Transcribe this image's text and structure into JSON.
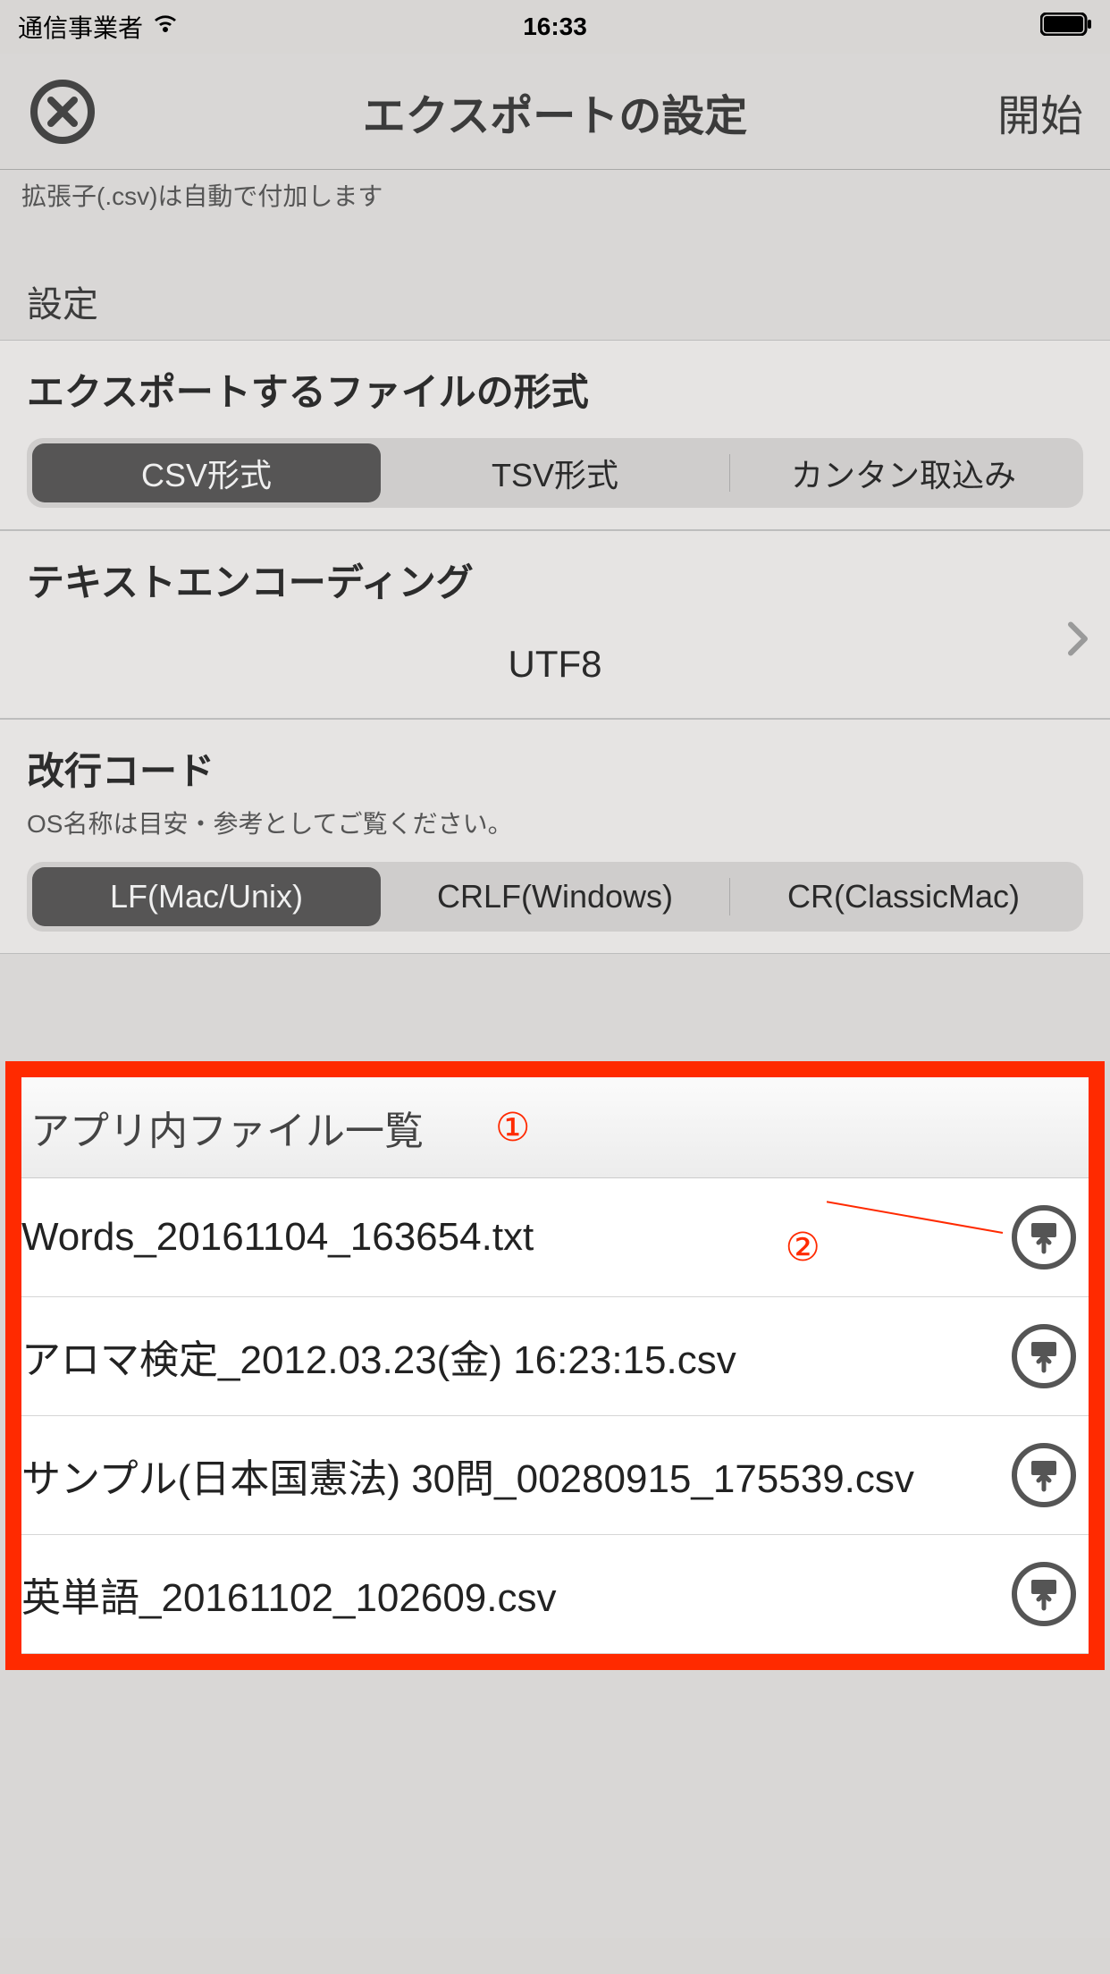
{
  "status": {
    "carrier": "通信事業者",
    "time": "16:33"
  },
  "nav": {
    "title": "エクスポートの設定",
    "start": "開始"
  },
  "hint": "拡張子(.csv)は自動で付加します",
  "sections": {
    "settings_header": "設定",
    "format": {
      "title": "エクスポートするファイルの形式",
      "options": [
        "CSV形式",
        "TSV形式",
        "カンタン取込み"
      ],
      "selected": 0
    },
    "encoding": {
      "title": "テキストエンコーディング",
      "value": "UTF8"
    },
    "newline": {
      "title": "改行コード",
      "sub": "OS名称は目安・参考としてご覧ください。",
      "options": [
        "LF(Mac/Unix)",
        "CRLF(Windows)",
        "CR(ClassicMac)"
      ],
      "selected": 0
    }
  },
  "files": {
    "header": "アプリ内ファイル一覧",
    "annotation1": "①",
    "annotation2": "②",
    "items": [
      "Words_20161104_163654.txt",
      "アロマ検定_2012.03.23(金) 16:23:15.csv",
      "サンプル(日本国憲法) 30問_00280915_175539.csv",
      "英単語_20161102_102609.csv"
    ]
  }
}
